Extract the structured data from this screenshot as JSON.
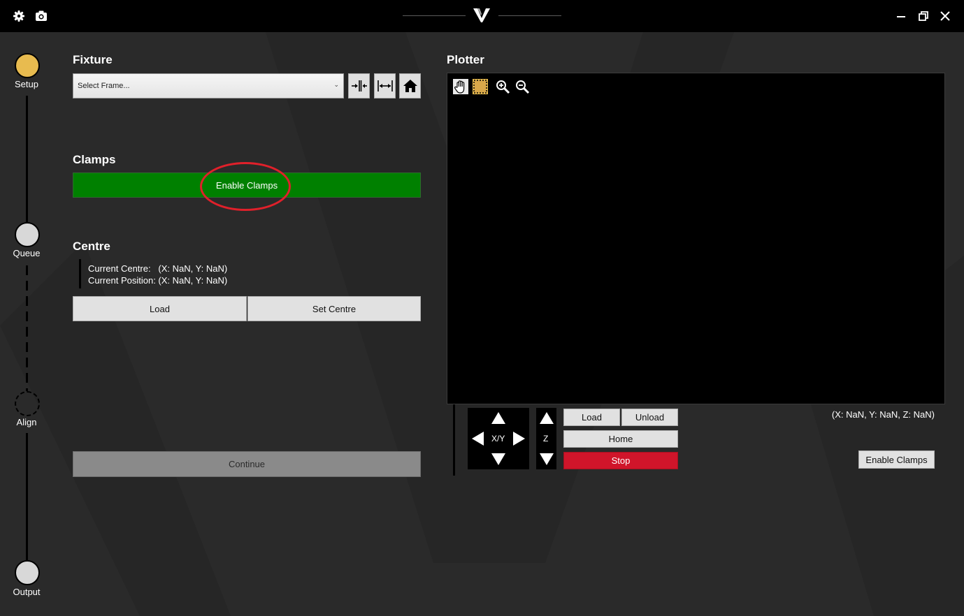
{
  "titlebar": {
    "icons": [
      "gear-icon",
      "camera-icon",
      "logo-v-icon",
      "minimize-icon",
      "restore-icon",
      "close-icon"
    ]
  },
  "stepper": {
    "steps": [
      {
        "label": "Setup",
        "state": "active",
        "color": "#e8bb4f"
      },
      {
        "label": "Queue",
        "state": "pending",
        "color": "#d8d8d8"
      },
      {
        "label": "Align",
        "state": "disabled",
        "color": "transparent"
      },
      {
        "label": "Output",
        "state": "pending",
        "color": "#d8d8d8"
      }
    ]
  },
  "fixture": {
    "title": "Fixture",
    "select_value": "Select Frame...",
    "icon_buttons": [
      "clamp-in-icon",
      "clamp-out-icon",
      "home-icon"
    ]
  },
  "clamps": {
    "title": "Clamps",
    "enable_label": "Enable Clamps"
  },
  "centre": {
    "title": "Centre",
    "current_centre": "Current Centre:   (X: NaN, Y: NaN)",
    "current_position": "Current Position: (X: NaN, Y: NaN)",
    "load_label": "Load",
    "set_centre_label": "Set Centre"
  },
  "continue_label": "Continue",
  "plotter": {
    "title": "Plotter",
    "tools": [
      "pan-hand-icon",
      "select-region-icon",
      "zoom-in-icon",
      "zoom-out-icon"
    ],
    "jog": {
      "xy_label": "X/Y",
      "z_label": "Z"
    },
    "load_label": "Load",
    "unload_label": "Unload",
    "home_label": "Home",
    "stop_label": "Stop",
    "coords": "(X: NaN, Y: NaN, Z: NaN)",
    "enable_clamps_label": "Enable Clamps"
  },
  "colors": {
    "accent_green": "#008000",
    "stop_red": "#d0152a",
    "setup_yellow": "#e8bb4f",
    "annotation_red": "#e0202a"
  }
}
